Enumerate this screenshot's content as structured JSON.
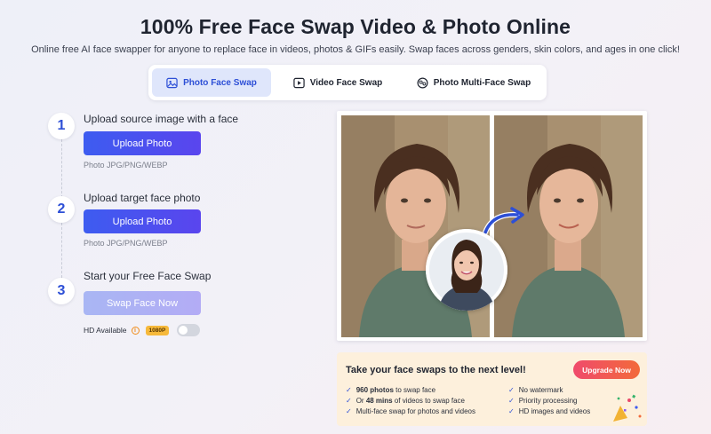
{
  "header": {
    "title": "100% Free Face Swap Video & Photo Online",
    "subtitle": "Online free AI face swapper for anyone to replace face in videos, photos & GIFs easily. Swap faces across genders, skin colors, and ages in one click!"
  },
  "tabs": [
    {
      "label": "Photo Face Swap",
      "icon": "image-icon"
    },
    {
      "label": "Video Face Swap",
      "icon": "video-icon"
    },
    {
      "label": "Photo Multi-Face Swap",
      "icon": "multi-face-icon"
    }
  ],
  "steps": [
    {
      "num": "1",
      "title": "Upload source image with a face",
      "button": "Upload Photo",
      "formats": "Photo JPG/PNG/WEBP"
    },
    {
      "num": "2",
      "title": "Upload target face photo",
      "button": "Upload Photo",
      "formats": "Photo JPG/PNG/WEBP"
    },
    {
      "num": "3",
      "title": "Start your Free Face Swap",
      "button": "Swap Face Now"
    }
  ],
  "hd": {
    "label": "HD Available",
    "badge": "1080P"
  },
  "upgrade": {
    "title": "Take your face swaps to the next level!",
    "button": "Upgrade Now",
    "features_left": [
      {
        "bold": "960 photos",
        "rest": " to swap face"
      },
      {
        "pre": "Or ",
        "bold": "48 mins",
        "rest": " of videos to swap face"
      },
      {
        "rest": "Multi-face swap for photos and videos"
      }
    ],
    "features_right": [
      "No watermark",
      "Priority processing",
      "HD images and videos"
    ]
  },
  "colors": {
    "accent": "#2d4fd6",
    "upgrade_bg": "#fdf0dc",
    "upgrade_btn": "#f04a6c"
  }
}
